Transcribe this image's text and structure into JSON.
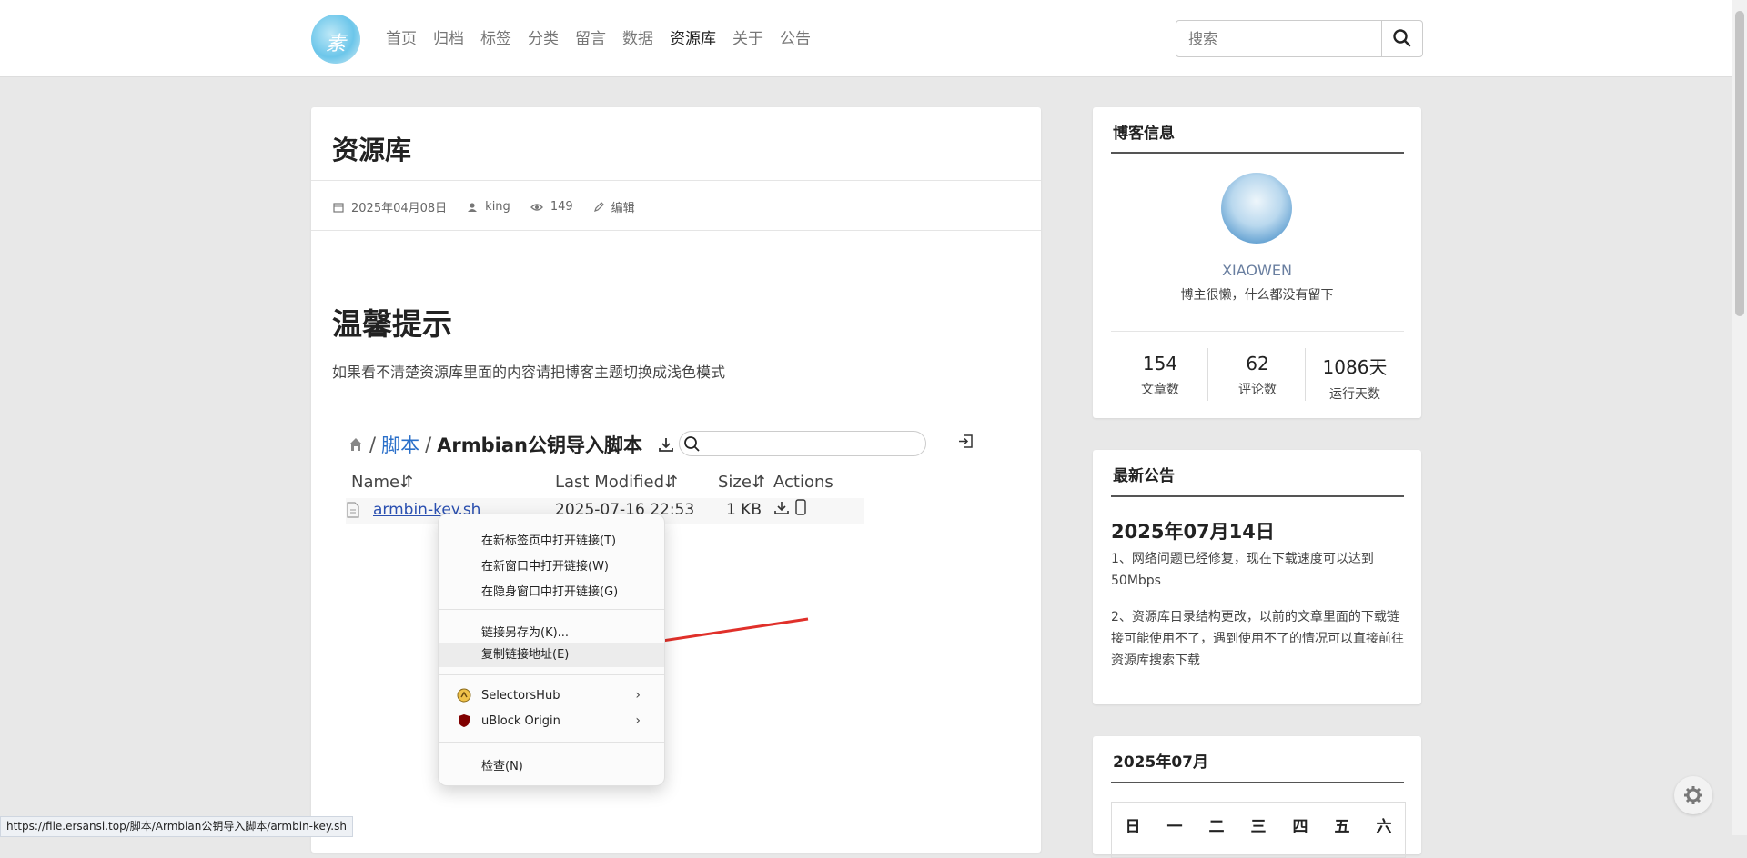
{
  "nav": {
    "logo_text": "素",
    "items": [
      "首页",
      "归档",
      "标签",
      "分类",
      "留言",
      "数据",
      "资源库",
      "关于",
      "公告"
    ],
    "active": "资源库"
  },
  "search": {
    "placeholder": "搜索"
  },
  "article": {
    "title": "资源库",
    "meta": {
      "date": "2025年04月08日",
      "author": "king",
      "views": "149",
      "edit": "编辑"
    },
    "heading": "温馨提示",
    "tip": "如果看不清楚资源库里面的内容请把博客主题切换成浅色模式"
  },
  "filebrowser": {
    "breadcrumb": {
      "sep": "/",
      "folder": "脚本",
      "current": "Armbian公钥导入脚本"
    },
    "columns": {
      "name": "Name",
      "modified": "Last Modified",
      "size": "Size",
      "actions": "Actions"
    },
    "sort_icon": "⇵",
    "file": {
      "name": "armbin-key.sh",
      "modified": "2025-07-16 22:53",
      "size": "1 KB"
    }
  },
  "blog_info": {
    "title": "博客信息",
    "name": "XIAOWEN",
    "desc": "博主很懒，什么都没有留下",
    "stats": [
      {
        "n": "154",
        "l": "文章数"
      },
      {
        "n": "62",
        "l": "评论数"
      },
      {
        "n": "1086天",
        "l": "运行天数"
      }
    ]
  },
  "notice": {
    "title": "最新公告",
    "date": "2025年07月14日",
    "p1": "1、网络问题已经修复，现在下载速度可以达到50Mbps",
    "p2": "2、资源库目录结构更改，以前的文章里面的下载链接可能使用不了，遇到使用不了的情况可以直接前往资源库搜索下载"
  },
  "calendar": {
    "title": "2025年07月",
    "weekdays": [
      "日",
      "一",
      "二",
      "三",
      "四",
      "五",
      "六"
    ]
  },
  "context_menu": {
    "open_tab": "在新标签页中打开链接(T)",
    "open_window": "在新窗口中打开链接(W)",
    "open_incognito": "在隐身窗口中打开链接(G)",
    "save_link": "链接另存为(K)...",
    "copy_link": "复制链接地址(E)",
    "selectorshub": "SelectorsHub",
    "ublock": "uBlock Origin",
    "inspect": "检查(N)"
  },
  "status_url": "https://file.ersansi.top/脚本/Armbian公钥导入脚本/armbin-key.sh",
  "colors": {
    "accent": "#2a6fc9",
    "annotation_arrow": "#e0302a"
  }
}
